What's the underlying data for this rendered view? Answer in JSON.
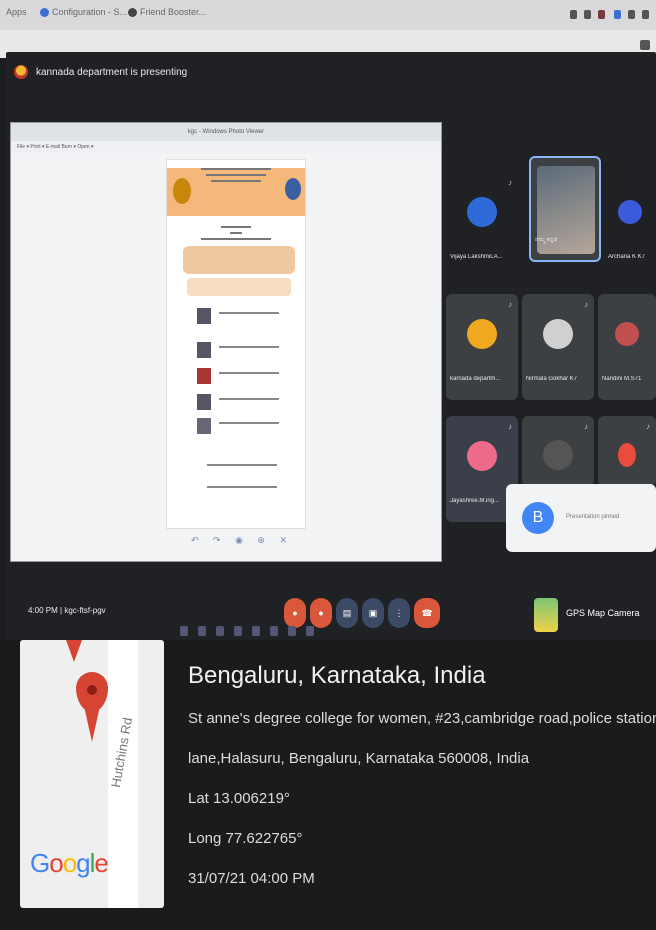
{
  "browser": {
    "bookmarks": [
      "Apps",
      "Configuration - S...",
      "Friend Booster..."
    ]
  },
  "meet": {
    "presenting_text": "kannada department is presenting",
    "shared_screen": {
      "window_title": "kgc - Windows Photo Viewer",
      "menu": "File ▾  Print ▾  E-mail  Burn ▾  Open ▾",
      "controls": "↶ ↷ ◉ ⊕ ✕"
    },
    "participants": [
      {
        "name": "Vijaya LakshmiLA...",
        "color": "#2f6bd8"
      },
      {
        "name": "ನಮ್ಮ ಕನ್ನಡ",
        "color": "#7a8a98"
      },
      {
        "name": "Archana K K7",
        "color": "#3b5bdb"
      },
      {
        "name": "karnada departm...",
        "color": "#f0a820"
      },
      {
        "name": "Nirmala Gokhar K7",
        "color": "#d0d0d0"
      },
      {
        "name": "Nandini M.S71",
        "color": "#c0504d"
      },
      {
        "name": "Jayashree.M.ing...",
        "color": "#f06b8b"
      },
      {
        "name": "D",
        "color": "#555"
      },
      {
        "name": "",
        "color": "#e74c3c"
      }
    ],
    "toast": {
      "avatar_letter": "B",
      "message": "Presentation pinned"
    },
    "time": "4:00 PM  |  kgc-ftsf-pgv",
    "controls": [
      "mic",
      "cam",
      "cc",
      "present",
      "more",
      "end"
    ],
    "gps_app": "GPS Map Camera"
  },
  "stamp": {
    "city": "Bengaluru, Karnataka, India",
    "address_line1": "St anne's degree college for women, #23,cambridge road,police station,",
    "address_line2": "lane,Halasuru, Bengaluru, Karnataka 560008, India",
    "lat": "Lat 13.006219°",
    "long": "Long 77.622765°",
    "datetime": "31/07/21 04:00 PM",
    "map": {
      "road_label": "Hutchins Rd",
      "brand": "Google"
    }
  }
}
